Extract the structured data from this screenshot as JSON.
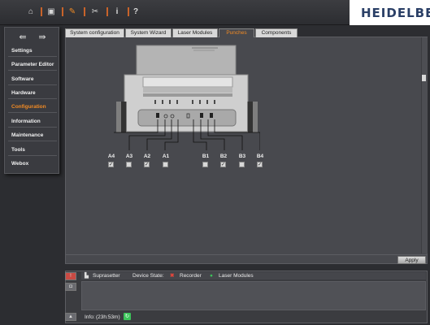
{
  "toolbar": {
    "logo": "HEIDELBE",
    "buttons": [
      {
        "name": "home-icon",
        "glyph": "⌂"
      },
      {
        "name": "document-icon",
        "glyph": "▣"
      },
      {
        "name": "wrench-icon",
        "glyph": "✎"
      },
      {
        "name": "tools-icon",
        "glyph": "✂"
      },
      {
        "name": "info-icon",
        "glyph": "i"
      },
      {
        "name": "help-icon",
        "glyph": "?"
      }
    ]
  },
  "sidebar": {
    "arrow_left": "⇚",
    "arrow_right": "⇛",
    "items": [
      {
        "label": "Settings"
      },
      {
        "label": "Parameter Editor"
      },
      {
        "label": "Software"
      },
      {
        "label": "Hardware"
      },
      {
        "label": "Configuration",
        "active": true
      },
      {
        "label": "Information"
      },
      {
        "label": "Maintenance"
      },
      {
        "label": "Tools"
      },
      {
        "label": "Webox"
      }
    ]
  },
  "tabs": [
    {
      "label": "System configuration"
    },
    {
      "label": "System Wizard"
    },
    {
      "label": "Laser Modules"
    },
    {
      "label": "Punches",
      "active": true
    },
    {
      "label": "Components"
    }
  ],
  "punches": {
    "items": [
      {
        "label": "A4",
        "checked": true
      },
      {
        "label": "A3",
        "checked": false
      },
      {
        "label": "A2",
        "checked": true
      },
      {
        "label": "A1",
        "checked": false
      },
      {
        "label": "B1",
        "checked": false
      },
      {
        "label": "B2",
        "checked": true
      },
      {
        "label": "B3",
        "checked": false
      },
      {
        "label": "B4",
        "checked": true
      }
    ],
    "apply_label": "Apply"
  },
  "status": {
    "device_name": "Suprasetter",
    "device_state_label": "Device State:",
    "recorder_label": "Recorder",
    "laser_modules_label": "Laser Modules",
    "info_label": "Info:",
    "info_time": "(23h:53m)",
    "colors": {
      "error": "#e0463c",
      "ok": "#3cc45a",
      "accent": "#f08a24"
    }
  }
}
